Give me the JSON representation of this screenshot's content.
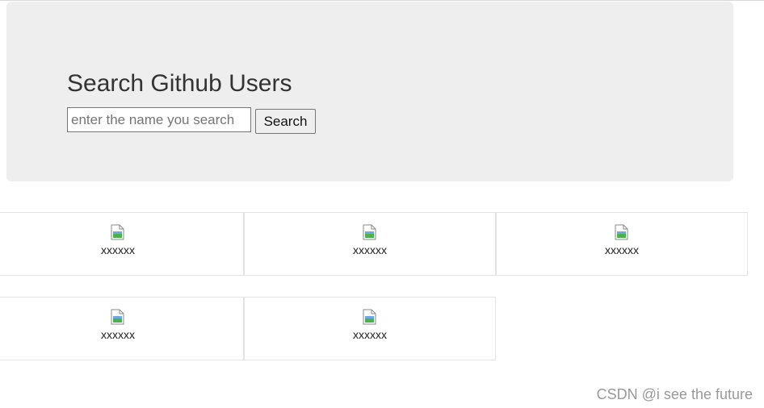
{
  "header": {
    "title": "Search Github Users",
    "search_placeholder": "enter the name you search",
    "search_button_label": "Search"
  },
  "users": [
    {
      "name": "xxxxxx"
    },
    {
      "name": "xxxxxx"
    },
    {
      "name": "xxxxxx"
    },
    {
      "name": "xxxxxx"
    },
    {
      "name": "xxxxxx"
    }
  ],
  "watermark": "CSDN @i see the future",
  "colors": {
    "jumbotron_bg": "#eeeeee",
    "card_border": "#e3e3e3",
    "button_bg": "#efefef"
  }
}
